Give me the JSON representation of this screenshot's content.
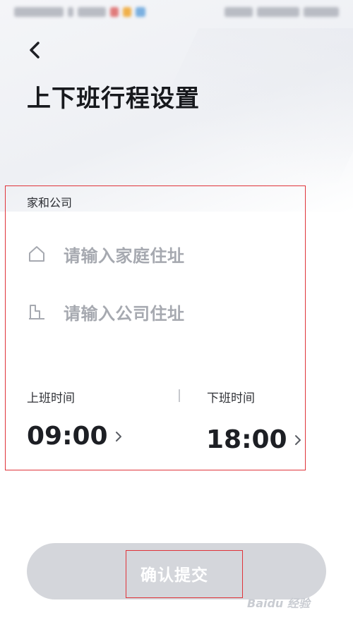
{
  "header": {
    "back_icon": "chevron-left-icon",
    "title": "上下班行程设置"
  },
  "commute": {
    "section_label": "家和公司",
    "home": {
      "icon": "home-outline-icon",
      "placeholder": "请输入家庭住址"
    },
    "office": {
      "icon": "office-building-icon",
      "placeholder": "请输入公司住址"
    },
    "start": {
      "label": "上班时间",
      "value": "09:00",
      "icon": "chevron-right-icon"
    },
    "end": {
      "label": "下班时间",
      "value": "18:00",
      "icon": "chevron-right-icon"
    }
  },
  "footer": {
    "submit_label": "确认提交"
  },
  "watermark": "Baidu 经验",
  "colors": {
    "highlight_border": "#e0343a",
    "button_disabled": "#d4d6db",
    "placeholder_text": "#a6a9b0"
  }
}
